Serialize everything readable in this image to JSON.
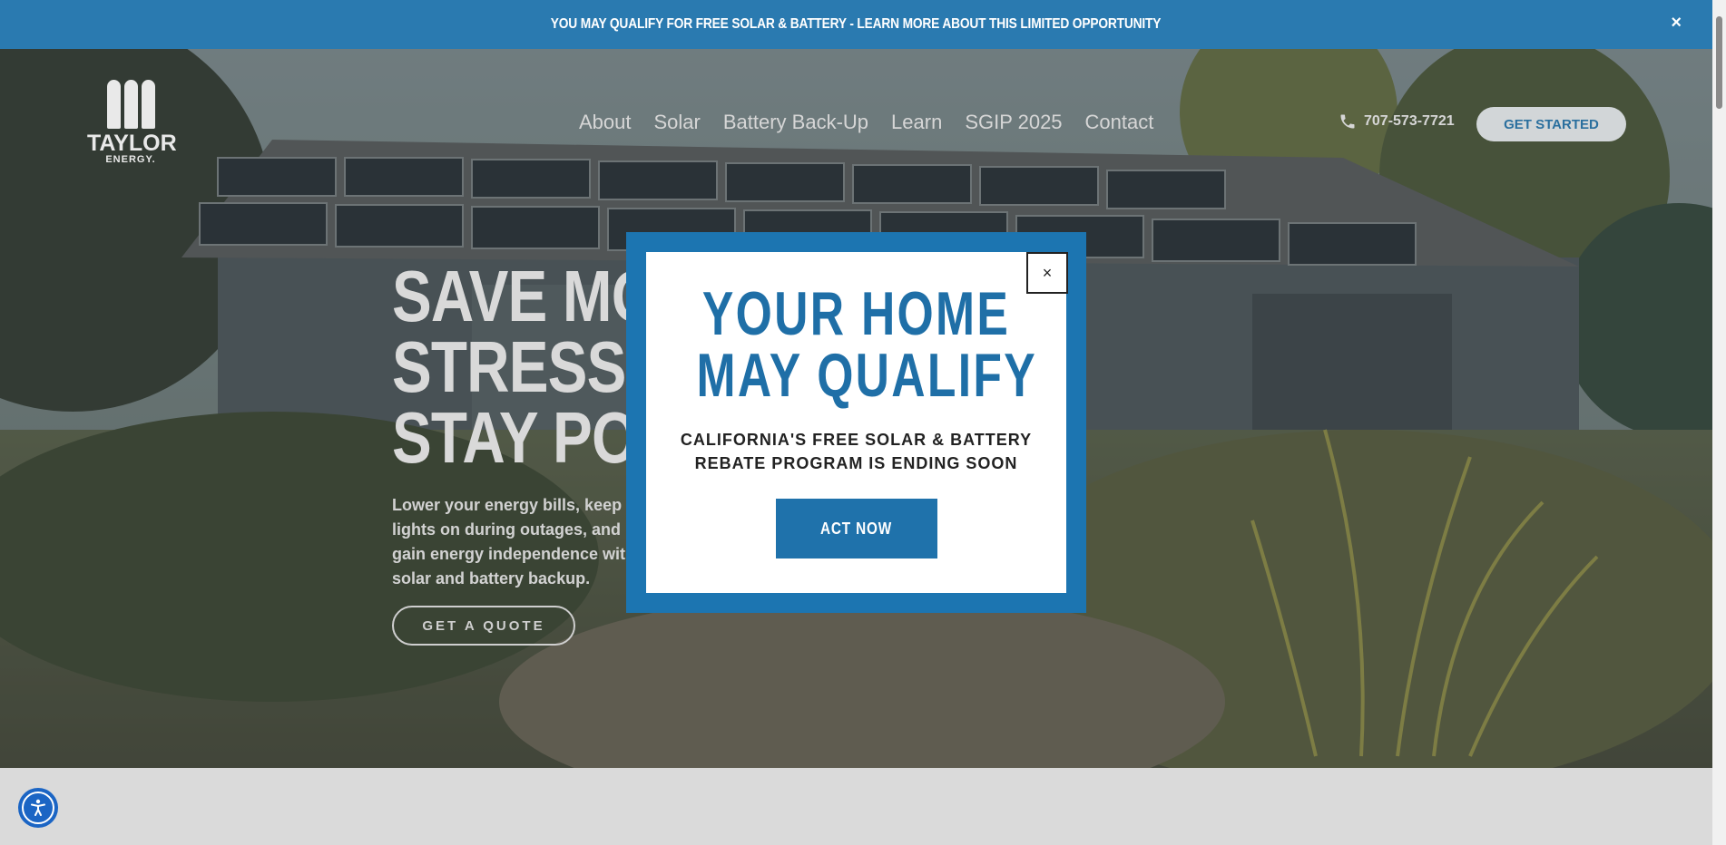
{
  "banner": {
    "text": "YOU MAY QUALIFY FOR FREE SOLAR & BATTERY - LEARN MORE ABOUT THIS LIMITED OPPORTUNITY",
    "close": "×"
  },
  "logo": {
    "name": "TAYLOR",
    "sub": "ENERGY."
  },
  "nav": {
    "items": [
      "About",
      "Solar",
      "Battery Back-Up",
      "Learn",
      "SGIP 2025",
      "Contact"
    ]
  },
  "header": {
    "phone": "707-573-7721",
    "cta": "GET STARTED"
  },
  "hero": {
    "headline_lines": [
      "SAVE MORE,",
      "STRESS LESS,",
      "STAY POWERED."
    ],
    "subtext": "Lower your energy bills, keep the lights on during outages, and gain energy independence with solar and battery backup.",
    "button": "GET A QUOTE"
  },
  "modal": {
    "close": "×",
    "title_lines": [
      "YOUR HOME",
      "MAY QUALIFY"
    ],
    "subtitle_lines": [
      "CALIFORNIA'S FREE SOLAR & BATTERY",
      "REBATE PROGRAM IS ENDING SOON"
    ],
    "button": "ACT NOW"
  },
  "colors": {
    "brand_blue": "#1c75b1",
    "banner_blue": "#2a7ab0",
    "a11y_blue": "#1b65c4"
  },
  "icons": [
    "close-icon",
    "phone-icon",
    "accessibility-icon"
  ]
}
